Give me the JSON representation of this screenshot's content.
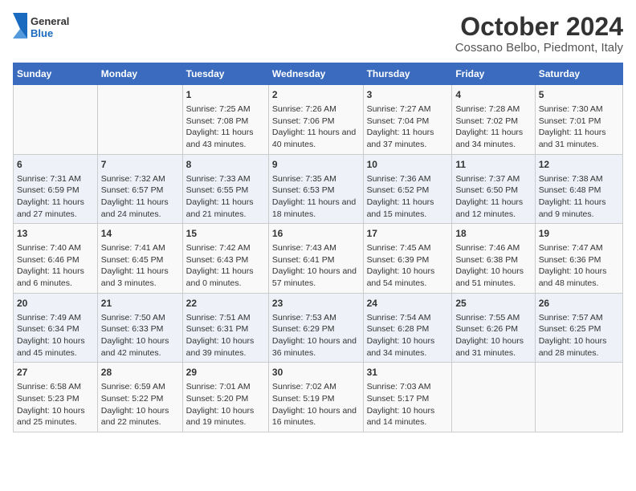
{
  "header": {
    "logo_general": "General",
    "logo_blue": "Blue",
    "title": "October 2024",
    "subtitle": "Cossano Belbo, Piedmont, Italy"
  },
  "calendar": {
    "weekdays": [
      "Sunday",
      "Monday",
      "Tuesday",
      "Wednesday",
      "Thursday",
      "Friday",
      "Saturday"
    ],
    "rows": [
      [
        {
          "day": "",
          "content": ""
        },
        {
          "day": "",
          "content": ""
        },
        {
          "day": "1",
          "content": "Sunrise: 7:25 AM\nSunset: 7:08 PM\nDaylight: 11 hours and 43 minutes."
        },
        {
          "day": "2",
          "content": "Sunrise: 7:26 AM\nSunset: 7:06 PM\nDaylight: 11 hours and 40 minutes."
        },
        {
          "day": "3",
          "content": "Sunrise: 7:27 AM\nSunset: 7:04 PM\nDaylight: 11 hours and 37 minutes."
        },
        {
          "day": "4",
          "content": "Sunrise: 7:28 AM\nSunset: 7:02 PM\nDaylight: 11 hours and 34 minutes."
        },
        {
          "day": "5",
          "content": "Sunrise: 7:30 AM\nSunset: 7:01 PM\nDaylight: 11 hours and 31 minutes."
        }
      ],
      [
        {
          "day": "6",
          "content": "Sunrise: 7:31 AM\nSunset: 6:59 PM\nDaylight: 11 hours and 27 minutes."
        },
        {
          "day": "7",
          "content": "Sunrise: 7:32 AM\nSunset: 6:57 PM\nDaylight: 11 hours and 24 minutes."
        },
        {
          "day": "8",
          "content": "Sunrise: 7:33 AM\nSunset: 6:55 PM\nDaylight: 11 hours and 21 minutes."
        },
        {
          "day": "9",
          "content": "Sunrise: 7:35 AM\nSunset: 6:53 PM\nDaylight: 11 hours and 18 minutes."
        },
        {
          "day": "10",
          "content": "Sunrise: 7:36 AM\nSunset: 6:52 PM\nDaylight: 11 hours and 15 minutes."
        },
        {
          "day": "11",
          "content": "Sunrise: 7:37 AM\nSunset: 6:50 PM\nDaylight: 11 hours and 12 minutes."
        },
        {
          "day": "12",
          "content": "Sunrise: 7:38 AM\nSunset: 6:48 PM\nDaylight: 11 hours and 9 minutes."
        }
      ],
      [
        {
          "day": "13",
          "content": "Sunrise: 7:40 AM\nSunset: 6:46 PM\nDaylight: 11 hours and 6 minutes."
        },
        {
          "day": "14",
          "content": "Sunrise: 7:41 AM\nSunset: 6:45 PM\nDaylight: 11 hours and 3 minutes."
        },
        {
          "day": "15",
          "content": "Sunrise: 7:42 AM\nSunset: 6:43 PM\nDaylight: 11 hours and 0 minutes."
        },
        {
          "day": "16",
          "content": "Sunrise: 7:43 AM\nSunset: 6:41 PM\nDaylight: 10 hours and 57 minutes."
        },
        {
          "day": "17",
          "content": "Sunrise: 7:45 AM\nSunset: 6:39 PM\nDaylight: 10 hours and 54 minutes."
        },
        {
          "day": "18",
          "content": "Sunrise: 7:46 AM\nSunset: 6:38 PM\nDaylight: 10 hours and 51 minutes."
        },
        {
          "day": "19",
          "content": "Sunrise: 7:47 AM\nSunset: 6:36 PM\nDaylight: 10 hours and 48 minutes."
        }
      ],
      [
        {
          "day": "20",
          "content": "Sunrise: 7:49 AM\nSunset: 6:34 PM\nDaylight: 10 hours and 45 minutes."
        },
        {
          "day": "21",
          "content": "Sunrise: 7:50 AM\nSunset: 6:33 PM\nDaylight: 10 hours and 42 minutes."
        },
        {
          "day": "22",
          "content": "Sunrise: 7:51 AM\nSunset: 6:31 PM\nDaylight: 10 hours and 39 minutes."
        },
        {
          "day": "23",
          "content": "Sunrise: 7:53 AM\nSunset: 6:29 PM\nDaylight: 10 hours and 36 minutes."
        },
        {
          "day": "24",
          "content": "Sunrise: 7:54 AM\nSunset: 6:28 PM\nDaylight: 10 hours and 34 minutes."
        },
        {
          "day": "25",
          "content": "Sunrise: 7:55 AM\nSunset: 6:26 PM\nDaylight: 10 hours and 31 minutes."
        },
        {
          "day": "26",
          "content": "Sunrise: 7:57 AM\nSunset: 6:25 PM\nDaylight: 10 hours and 28 minutes."
        }
      ],
      [
        {
          "day": "27",
          "content": "Sunrise: 6:58 AM\nSunset: 5:23 PM\nDaylight: 10 hours and 25 minutes."
        },
        {
          "day": "28",
          "content": "Sunrise: 6:59 AM\nSunset: 5:22 PM\nDaylight: 10 hours and 22 minutes."
        },
        {
          "day": "29",
          "content": "Sunrise: 7:01 AM\nSunset: 5:20 PM\nDaylight: 10 hours and 19 minutes."
        },
        {
          "day": "30",
          "content": "Sunrise: 7:02 AM\nSunset: 5:19 PM\nDaylight: 10 hours and 16 minutes."
        },
        {
          "day": "31",
          "content": "Sunrise: 7:03 AM\nSunset: 5:17 PM\nDaylight: 10 hours and 14 minutes."
        },
        {
          "day": "",
          "content": ""
        },
        {
          "day": "",
          "content": ""
        }
      ]
    ]
  }
}
